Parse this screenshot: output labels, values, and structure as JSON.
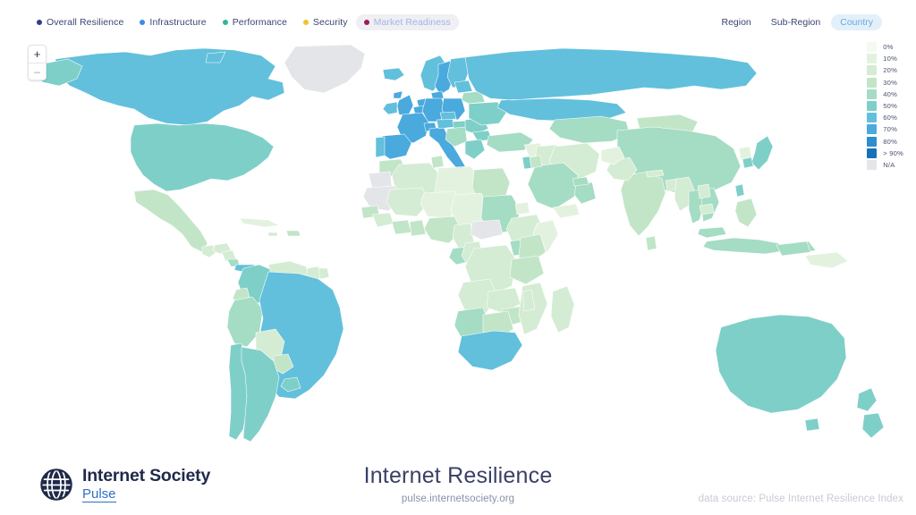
{
  "metrics": [
    {
      "label": "Overall Resilience",
      "color": "#2f3e8c",
      "active": true
    },
    {
      "label": "Infrastructure",
      "color": "#3d8ae8",
      "active": true
    },
    {
      "label": "Performance",
      "color": "#2cb99a",
      "active": true
    },
    {
      "label": "Security",
      "color": "#f2c230",
      "active": true
    },
    {
      "label": "Market Readiness",
      "color": "#9b1c58",
      "active": false
    }
  ],
  "scope": {
    "options": [
      "Region",
      "Sub-Region",
      "Country"
    ],
    "selected": "Country"
  },
  "zoom_control": {
    "in_label": "+",
    "out_label": "–"
  },
  "scale": {
    "items": [
      {
        "label": "0%",
        "color": "#f4faf2"
      },
      {
        "label": "10%",
        "color": "#e3f2de"
      },
      {
        "label": "20%",
        "color": "#d4ecd3"
      },
      {
        "label": "30%",
        "color": "#c2e5c8"
      },
      {
        "label": "40%",
        "color": "#a5dcc4"
      },
      {
        "label": "50%",
        "color": "#7fcfc9"
      },
      {
        "label": "60%",
        "color": "#62c0dc"
      },
      {
        "label": "70%",
        "color": "#4aa9dd"
      },
      {
        "label": "80%",
        "color": "#2f8ccd"
      },
      {
        "label": "> 90%",
        "color": "#1572b8"
      },
      {
        "label": "N/A",
        "color": "#e4e5e9"
      }
    ]
  },
  "logo": {
    "name": "Internet Society",
    "product": "Pulse",
    "mark": "globe-icon"
  },
  "title": {
    "heading": "Internet Resilience",
    "url": "pulse.internetsociety.org"
  },
  "source": {
    "text": "data source: Pulse Internet Resilience Index"
  },
  "chart_data": {
    "type": "map-choropleth",
    "title": "Internet Resilience",
    "metric": "Overall Resilience",
    "granularity": "Country",
    "legend_position": "right",
    "value_unit": "percent",
    "bins": [
      "0%",
      "10%",
      "20%",
      "30%",
      "40%",
      "50%",
      "60%",
      "70%",
      "80%",
      ">90%",
      "N/A"
    ],
    "regions": [
      {
        "name": "Canada",
        "value": 65
      },
      {
        "name": "United States",
        "value": 52
      },
      {
        "name": "Greenland",
        "value": null
      },
      {
        "name": "Mexico",
        "value": 34
      },
      {
        "name": "Guatemala",
        "value": 26
      },
      {
        "name": "Honduras",
        "value": 24
      },
      {
        "name": "Nicaragua",
        "value": 26
      },
      {
        "name": "Costa Rica",
        "value": 44
      },
      {
        "name": "Panama",
        "value": 62
      },
      {
        "name": "Cuba",
        "value": 18
      },
      {
        "name": "Dominican Republic",
        "value": 32
      },
      {
        "name": "Brazil",
        "value": 63
      },
      {
        "name": "Argentina",
        "value": 55
      },
      {
        "name": "Chile",
        "value": 58
      },
      {
        "name": "Uruguay",
        "value": 55
      },
      {
        "name": "Paraguay",
        "value": 30
      },
      {
        "name": "Bolivia",
        "value": 26
      },
      {
        "name": "Peru",
        "value": 42
      },
      {
        "name": "Ecuador",
        "value": 36
      },
      {
        "name": "Colombia",
        "value": 55
      },
      {
        "name": "Venezuela",
        "value": 28
      },
      {
        "name": "Guyana",
        "value": 26
      },
      {
        "name": "Suriname",
        "value": 24
      },
      {
        "name": "United Kingdom",
        "value": 74
      },
      {
        "name": "Ireland",
        "value": 66
      },
      {
        "name": "France",
        "value": 72
      },
      {
        "name": "Spain",
        "value": 74
      },
      {
        "name": "Portugal",
        "value": 66
      },
      {
        "name": "Germany",
        "value": 72
      },
      {
        "name": "Netherlands",
        "value": 78
      },
      {
        "name": "Belgium",
        "value": 72
      },
      {
        "name": "Switzerland",
        "value": 74
      },
      {
        "name": "Italy",
        "value": 72
      },
      {
        "name": "Austria",
        "value": 68
      },
      {
        "name": "Poland",
        "value": 72
      },
      {
        "name": "Czechia",
        "value": 66
      },
      {
        "name": "Hungary",
        "value": 58
      },
      {
        "name": "Romania",
        "value": 58
      },
      {
        "name": "Bulgaria",
        "value": 55
      },
      {
        "name": "Greece",
        "value": 52
      },
      {
        "name": "Norway",
        "value": 68
      },
      {
        "name": "Sweden",
        "value": 72
      },
      {
        "name": "Finland",
        "value": 68
      },
      {
        "name": "Denmark",
        "value": 74
      },
      {
        "name": "Iceland",
        "value": 62
      },
      {
        "name": "Russia",
        "value": 60
      },
      {
        "name": "Ukraine",
        "value": 52
      },
      {
        "name": "Belarus",
        "value": 46
      },
      {
        "name": "Turkey",
        "value": 44
      },
      {
        "name": "Kazakhstan",
        "value": 40
      },
      {
        "name": "China",
        "value": 42
      },
      {
        "name": "Mongolia",
        "value": 38
      },
      {
        "name": "Japan",
        "value": 55
      },
      {
        "name": "South Korea",
        "value": 58
      },
      {
        "name": "India",
        "value": 32
      },
      {
        "name": "Pakistan",
        "value": 24
      },
      {
        "name": "Bangladesh",
        "value": 26
      },
      {
        "name": "Thailand",
        "value": 42
      },
      {
        "name": "Vietnam",
        "value": 40
      },
      {
        "name": "Malaysia",
        "value": 46
      },
      {
        "name": "Indonesia",
        "value": 40
      },
      {
        "name": "Philippines",
        "value": 38
      },
      {
        "name": "Saudi Arabia",
        "value": 42
      },
      {
        "name": "Iran",
        "value": 28
      },
      {
        "name": "Iraq",
        "value": 22
      },
      {
        "name": "Egypt",
        "value": 30
      },
      {
        "name": "Libya",
        "value": 18
      },
      {
        "name": "Algeria",
        "value": 24
      },
      {
        "name": "Morocco",
        "value": 32
      },
      {
        "name": "Sudan",
        "value": 42
      },
      {
        "name": "Chad",
        "value": 16
      },
      {
        "name": "Niger",
        "value": 18
      },
      {
        "name": "Mali",
        "value": 20
      },
      {
        "name": "Nigeria",
        "value": 30
      },
      {
        "name": "Ethiopia",
        "value": 22
      },
      {
        "name": "Kenya",
        "value": 38
      },
      {
        "name": "Tanzania",
        "value": 30
      },
      {
        "name": "Uganda",
        "value": 42
      },
      {
        "name": "Angola",
        "value": 26
      },
      {
        "name": "Congo DR",
        "value": 22
      },
      {
        "name": "Zambia",
        "value": 28
      },
      {
        "name": "Zimbabwe",
        "value": 30
      },
      {
        "name": "Mozambique",
        "value": 26
      },
      {
        "name": "Namibia",
        "value": 42
      },
      {
        "name": "Botswana",
        "value": 36
      },
      {
        "name": "South Africa",
        "value": 62
      },
      {
        "name": "Madagascar",
        "value": 24
      },
      {
        "name": "Western Sahara",
        "value": null
      },
      {
        "name": "Central African Republic",
        "value": null
      },
      {
        "name": "Australia",
        "value": 56
      },
      {
        "name": "New Zealand",
        "value": 58
      },
      {
        "name": "Papua New Guinea",
        "value": 18
      }
    ]
  }
}
